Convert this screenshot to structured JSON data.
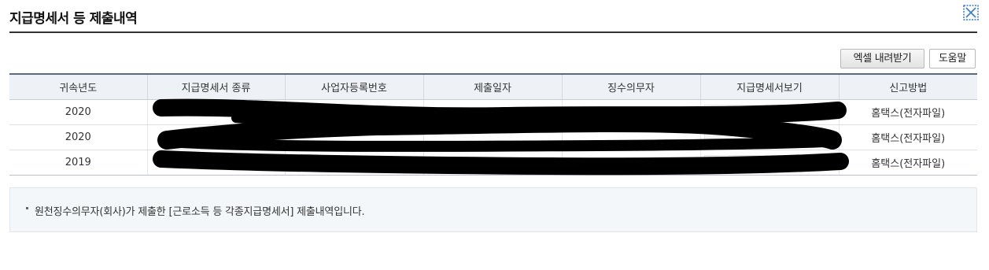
{
  "header": {
    "title": "지급명세서 등 제출내역"
  },
  "icons": {
    "close": "close-icon"
  },
  "toolbar": {
    "excel_label": "엑셀 내려받기",
    "help_label": "도움말"
  },
  "table": {
    "columns": [
      "귀속년도",
      "지급명세서 종류",
      "사업자등록번호",
      "제출일자",
      "징수의무자",
      "지급명세서보기",
      "신고방법"
    ],
    "rows": [
      {
        "year": "2020",
        "method": "홈택스(전자파일)"
      },
      {
        "year": "2020",
        "method": "홈택스(전자파일)"
      },
      {
        "year": "2019",
        "method": "홈택스(전자파일)"
      }
    ]
  },
  "notice": {
    "text": "원천징수의무자(회사)가 제출한 [근로소득 등 각종지급명세서] 제출내역입니다."
  }
}
